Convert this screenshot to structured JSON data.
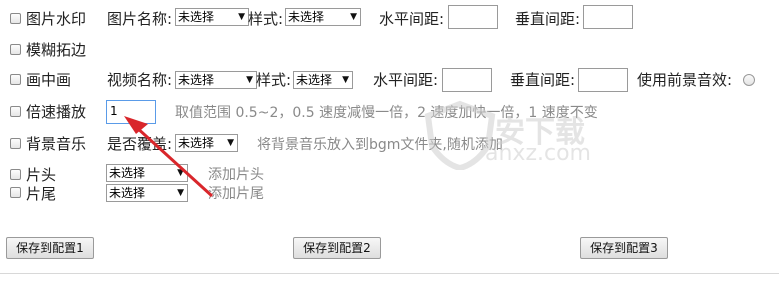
{
  "rows": {
    "image_watermark": {
      "checkbox_label": "图片水印",
      "name_label": "图片名称:",
      "name_select": "未选择",
      "style_label": "样式:",
      "style_select": "未选择",
      "h_spacing_label": "水平间距:",
      "h_spacing_value": "",
      "v_spacing_label": "垂直间距:",
      "v_spacing_value": ""
    },
    "blur_expand": {
      "checkbox_label": "模糊拓边"
    },
    "pip": {
      "checkbox_label": "画中画",
      "video_label": "视频名称:",
      "video_select": "未选择",
      "style_label": "样式:",
      "style_select": "未选择",
      "h_spacing_label": "水平间距:",
      "h_spacing_value": "",
      "v_spacing_label": "垂直间距:",
      "v_spacing_value": "",
      "use_fg_audio_label": "使用前景音效:"
    },
    "speed": {
      "checkbox_label": "倍速播放",
      "value": "1",
      "hint": "取值范围 0.5~2，0.5 速度减慢一倍，2 速度加快一倍，1 速度不变"
    },
    "bgm": {
      "checkbox_label": "背景音乐",
      "overwrite_label": "是否覆盖:",
      "overwrite_select": "未选择",
      "hint": "将背景音乐放入到bgm文件夹,随机添加"
    },
    "intro": {
      "checkbox_label": "片头",
      "select": "未选择",
      "hint": "添加片头"
    },
    "outro": {
      "checkbox_label": "片尾",
      "select": "未选择",
      "hint": "添加片尾"
    }
  },
  "buttons": {
    "save1": "保存到配置1",
    "save2": "保存到配置2",
    "save3": "保存到配置3"
  },
  "watermark": {
    "text": "安下载",
    "url": "anxz.com",
    "color": "#d0d0d0"
  },
  "colors": {
    "arrow": "#d9262b",
    "hint_text": "#8a8a8a"
  },
  "icons": {
    "select_arrow": "▼"
  }
}
